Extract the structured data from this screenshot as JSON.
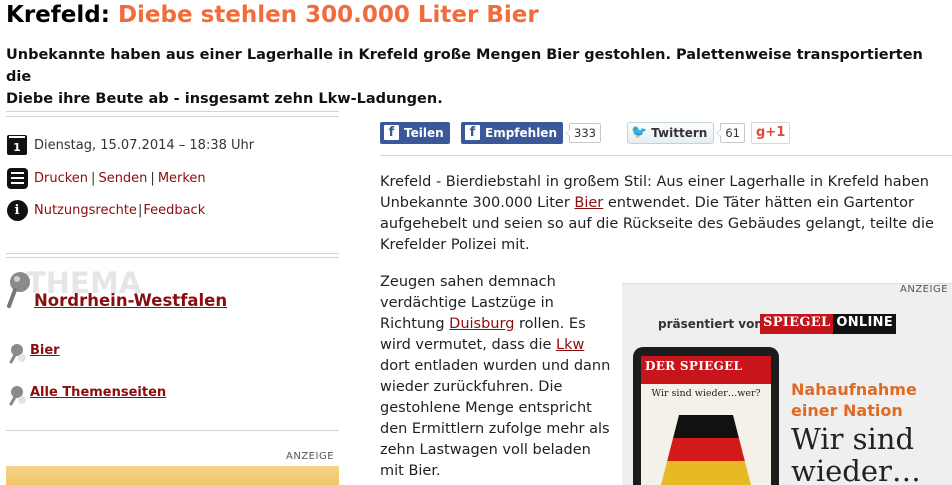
{
  "article": {
    "kicker": "Krefeld: ",
    "title": "Diebe stehlen 300.000 Liter Bier",
    "teaser_line1": "Unbekannte haben aus einer Lagerhalle in Krefeld große Mengen Bier gestohlen. Palettenweise transportierten die",
    "teaser_line2": "Diebe ihre Beute ab - insgesamt zehn Lkw-Ladungen."
  },
  "meta": {
    "calendar_day": "1",
    "date": "Dienstag, 15.07.2014 – 18:38 Uhr",
    "print": "Drucken",
    "send": "Senden",
    "save": "Merken",
    "rights": "Nutzungsrechte",
    "feedback": "Feedback",
    "separator": "|"
  },
  "thema": {
    "bg_label": "THEMA",
    "title": "Nordrhein-Westfalen",
    "links": [
      "Bier",
      "Alle Themenseiten"
    ]
  },
  "ads": {
    "label_left": "ANZEIGE",
    "label_right": "ANZEIGE",
    "presented_by": "präsentiert von",
    "logo_red": "SPIEGEL",
    "logo_black": "ONLINE",
    "cover_masthead": "DER SPIEGEL",
    "cover_title": "Wir sind wieder…wer?",
    "slogan_line1": "Nahaufnahme",
    "slogan_line2": "einer Nation",
    "big_line1": "Wir sind",
    "big_line2": "wieder…"
  },
  "share": {
    "fb_share": "Teilen",
    "fb_recommend": "Empfehlen",
    "fb_count": "333",
    "twitter": "Twittern",
    "twitter_count": "61",
    "gplus": "g+1"
  },
  "body": {
    "p1_a": "Krefeld - Bierdiebstahl in großem Stil: Aus einer Lagerhalle in Krefeld haben Unbekannte 300.000 Liter ",
    "p1_link": "Bier",
    "p1_b": " entwendet. Die Täter hätten ein Gartentor aufgehebelt und seien so auf die Rückseite des Gebäudes gelangt, teilte die Krefelder Polizei mit.",
    "p2_a": "Zeugen sahen demnach verdächtige Lastzüge in Richtung ",
    "p2_link1": "Duisburg",
    "p2_b": " rollen. Es wird vermutet, dass die ",
    "p2_link2": "Lkw",
    "p2_c": " dort entladen wurden und dann wieder zurückfuhren. Die gestohlene Menge entspricht den Ermittlern zufolge mehr als zehn Lastwagen voll beladen mit Bier."
  },
  "colors": {
    "title_accent": "#f26b3a",
    "link": "#8b0d0d",
    "facebook": "#3b5998",
    "spiegel_red": "#c4141b"
  },
  "icons": [
    "calendar-icon",
    "menu-icon",
    "info-icon",
    "pin-icon",
    "facebook-icon",
    "twitter-bird-icon"
  ]
}
